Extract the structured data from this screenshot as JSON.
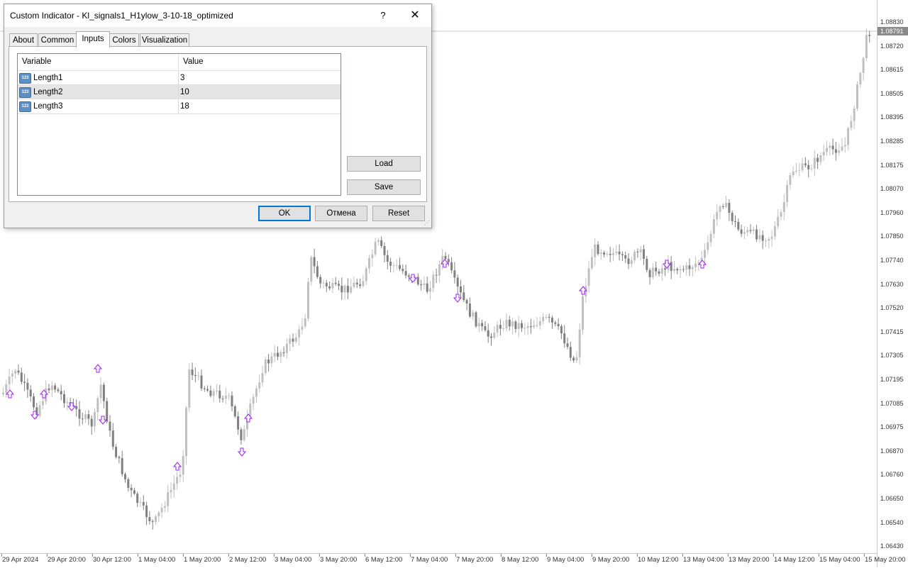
{
  "dialog": {
    "title": "Custom Indicator - Kl_signals1_H1ylow_3-10-18_optimized",
    "help_label": "?",
    "close_label": "✕",
    "tabs": [
      "About",
      "Common",
      "Inputs",
      "Colors",
      "Visualization"
    ],
    "active_tab": "Inputs",
    "table_headers": {
      "variable": "Variable",
      "value": "Value"
    },
    "inputs": [
      {
        "icon": "123",
        "variable": "Length1",
        "value": "3"
      },
      {
        "icon": "123",
        "variable": "Length2",
        "value": "10"
      },
      {
        "icon": "123",
        "variable": "Length3",
        "value": "18"
      }
    ],
    "load_label": "Load",
    "save_label": "Save",
    "ok_label": "OK",
    "cancel_label": "Отмена",
    "reset_label": "Reset",
    "accent_color": "#0078d7"
  },
  "chart": {
    "price_labels": [
      "1.08830",
      "1.08720",
      "1.08615",
      "1.08505",
      "1.08395",
      "1.08285",
      "1.08175",
      "1.08070",
      "1.07960",
      "1.07850",
      "1.07740",
      "1.07630",
      "1.07520",
      "1.07415",
      "1.07305",
      "1.07195",
      "1.07085",
      "1.06975",
      "1.06870",
      "1.06760",
      "1.06650",
      "1.06540",
      "1.06430"
    ],
    "current_price": "1.08791",
    "time_labels": [
      "29 Apr 2024",
      "29 Apr 20:00",
      "30 Apr 12:00",
      "1 May 04:00",
      "1 May 20:00",
      "2 May 12:00",
      "3 May 04:00",
      "3 May 20:00",
      "6 May 12:00",
      "7 May 04:00",
      "7 May 20:00",
      "8 May 12:00",
      "9 May 04:00",
      "9 May 20:00",
      "10 May 12:00",
      "13 May 04:00",
      "13 May 20:00",
      "14 May 12:00",
      "15 May 04:00",
      "15 May 20:00"
    ],
    "bull_color": "#c0c0c0",
    "bear_color": "#808080",
    "signal_color": "#a020f0"
  }
}
